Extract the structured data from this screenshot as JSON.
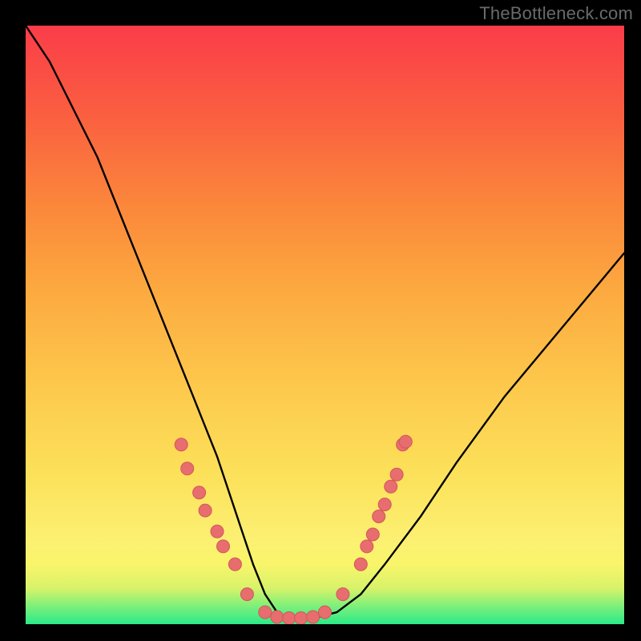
{
  "watermark": "TheBottleneck.com",
  "colors": {
    "curve_stroke": "#000000",
    "marker_fill": "#e76d6f",
    "marker_stroke": "#d45658",
    "bg": "#000000"
  },
  "chart_data": {
    "type": "line",
    "title": "",
    "xlabel": "",
    "ylabel": "",
    "xlim": [
      0,
      100
    ],
    "ylim": [
      0,
      100
    ],
    "grid": false,
    "series": [
      {
        "name": "bottleneck-curve",
        "x": [
          0,
          4,
          8,
          12,
          16,
          20,
          24,
          28,
          32,
          34,
          36,
          38,
          40,
          42,
          44,
          46,
          48,
          52,
          56,
          60,
          66,
          72,
          80,
          90,
          100
        ],
        "y": [
          100,
          94,
          86,
          78,
          68,
          58,
          48,
          38,
          28,
          22,
          16,
          10,
          5,
          2,
          1,
          1,
          1,
          2,
          5,
          10,
          18,
          27,
          38,
          50,
          62
        ]
      }
    ],
    "markers": [
      {
        "name": "left-cluster",
        "x": 26,
        "y": 30
      },
      {
        "name": "left-cluster",
        "x": 27,
        "y": 26
      },
      {
        "name": "left-cluster",
        "x": 29,
        "y": 22
      },
      {
        "name": "left-cluster",
        "x": 30,
        "y": 19
      },
      {
        "name": "left-cluster",
        "x": 32,
        "y": 15.5
      },
      {
        "name": "left-cluster",
        "x": 33,
        "y": 13
      },
      {
        "name": "left-cluster",
        "x": 35,
        "y": 10
      },
      {
        "name": "left-cluster",
        "x": 37,
        "y": 5
      },
      {
        "name": "bottom",
        "x": 40,
        "y": 2
      },
      {
        "name": "bottom",
        "x": 42,
        "y": 1.2
      },
      {
        "name": "bottom",
        "x": 44,
        "y": 1
      },
      {
        "name": "bottom",
        "x": 46,
        "y": 1
      },
      {
        "name": "bottom",
        "x": 48,
        "y": 1.2
      },
      {
        "name": "bottom",
        "x": 50,
        "y": 2
      },
      {
        "name": "right-cluster",
        "x": 53,
        "y": 5
      },
      {
        "name": "right-cluster",
        "x": 56,
        "y": 10
      },
      {
        "name": "right-cluster",
        "x": 57,
        "y": 13
      },
      {
        "name": "right-cluster",
        "x": 58,
        "y": 15
      },
      {
        "name": "right-cluster",
        "x": 59,
        "y": 18
      },
      {
        "name": "right-cluster",
        "x": 60,
        "y": 20
      },
      {
        "name": "right-cluster",
        "x": 61,
        "y": 23
      },
      {
        "name": "right-cluster",
        "x": 62,
        "y": 25
      },
      {
        "name": "right-cluster",
        "x": 63,
        "y": 30
      },
      {
        "name": "right-cluster",
        "x": 63.5,
        "y": 30.5
      }
    ]
  }
}
